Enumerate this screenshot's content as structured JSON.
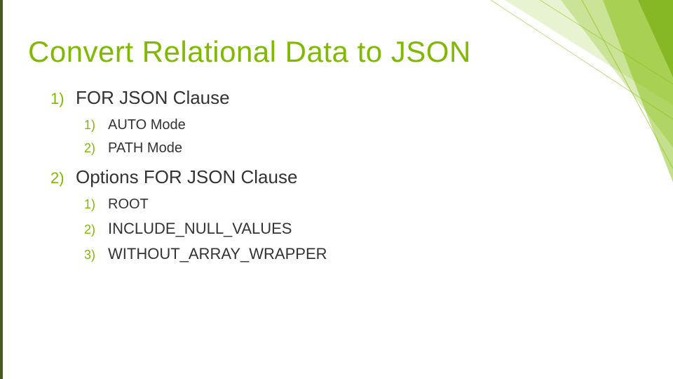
{
  "title": "Convert Relational Data to JSON",
  "items": [
    {
      "num": "1)",
      "text": "FOR JSON Clause",
      "children": [
        {
          "num": "1)",
          "text": "AUTO Mode"
        },
        {
          "num": "2)",
          "text": "PATH Mode"
        }
      ]
    },
    {
      "num": "2)",
      "text": "Options FOR JSON Clause",
      "children": [
        {
          "num": "1)",
          "text": "ROOT"
        },
        {
          "num": "2)",
          "text": "INCLUDE_NULL_VALUES"
        },
        {
          "num": "3)",
          "text": "WITHOUT_ARRAY_WRAPPER"
        }
      ]
    }
  ],
  "accent": "#7fba00"
}
